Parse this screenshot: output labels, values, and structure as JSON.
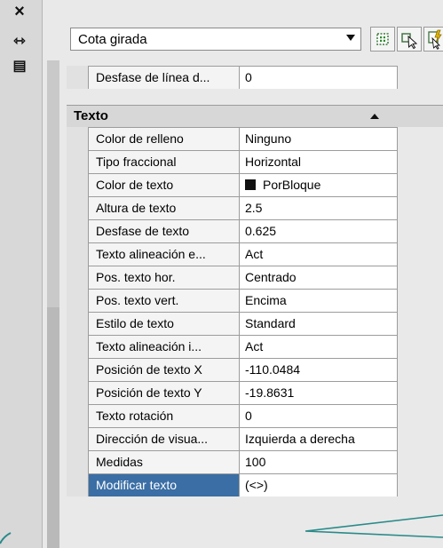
{
  "titlebar": {
    "close_glyph": "×",
    "autohide_glyph": "⇿",
    "properties_glyph": "▤"
  },
  "header": {
    "selected_object": "Cota girada"
  },
  "toolbar": {
    "icons": [
      "toggle-pickadd-icon",
      "select-objects-icon",
      "quick-select-icon"
    ]
  },
  "grid": {
    "above": {
      "name": "Desfase de línea d...",
      "value": "0"
    },
    "section_title": "Texto",
    "rows": [
      {
        "name": "Color de relleno",
        "value": "Ninguno"
      },
      {
        "name": "Tipo fraccional",
        "value": "Horizontal"
      },
      {
        "name": "Color de texto",
        "value": "PorBloque"
      },
      {
        "name": "Altura de texto",
        "value": "2.5"
      },
      {
        "name": "Desfase de texto",
        "value": "0.625"
      },
      {
        "name": "Texto alineación e...",
        "value": "Act"
      },
      {
        "name": "Pos. texto hor.",
        "value": "Centrado"
      },
      {
        "name": "Pos. texto vert.",
        "value": "Encima"
      },
      {
        "name": "Estilo de texto",
        "value": "Standard"
      },
      {
        "name": "Texto alineación i...",
        "value": "Act"
      },
      {
        "name": "Posición de texto X",
        "value": "-110.0484"
      },
      {
        "name": "Posición de texto Y",
        "value": "-19.8631"
      },
      {
        "name": "Texto rotación",
        "value": "0"
      },
      {
        "name": "Dirección de visua...",
        "value": "Izquierda a derecha"
      },
      {
        "name": "Medidas",
        "value": "100"
      },
      {
        "name": "Modificar texto",
        "value": "(<>)"
      }
    ]
  },
  "colors": {
    "selection": "#3a6ea5",
    "callout": "#2a8a8a",
    "swatch": "#111111"
  }
}
